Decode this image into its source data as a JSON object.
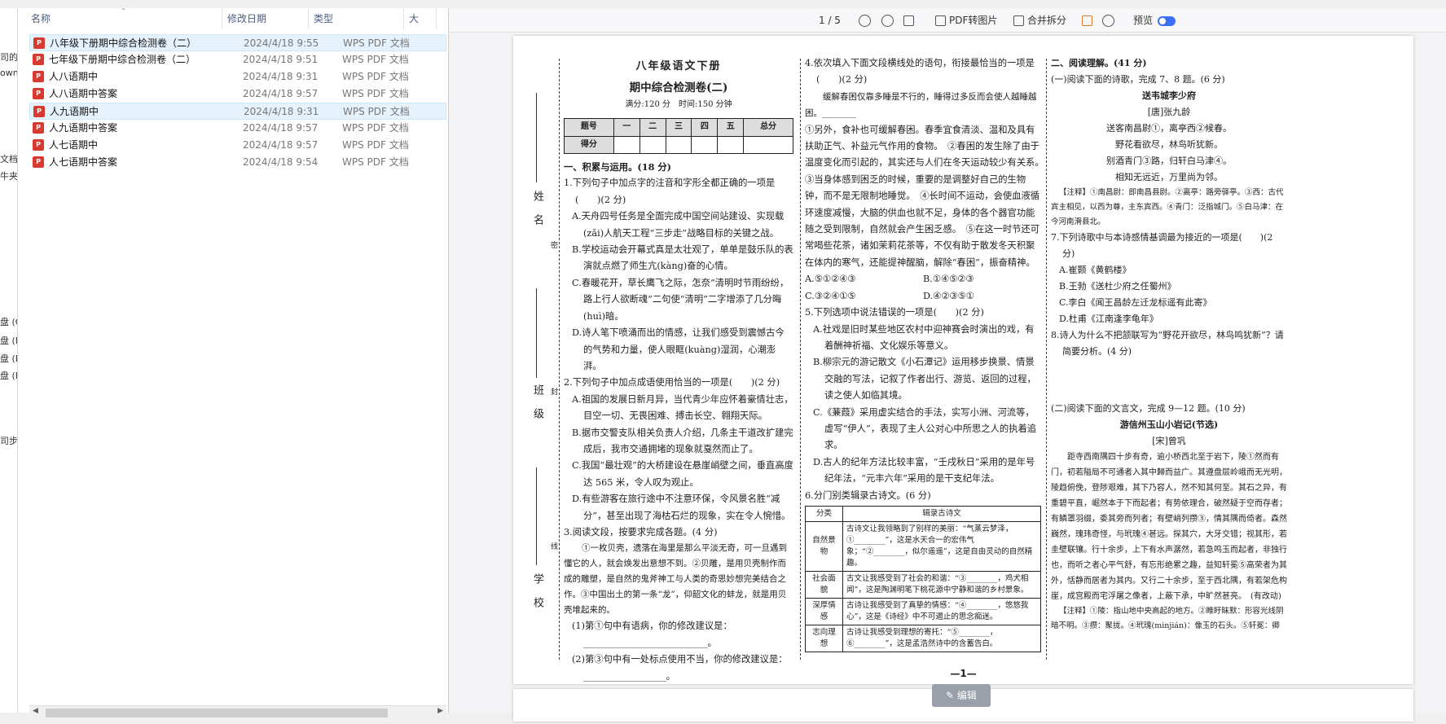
{
  "left_strip": {
    "items": [
      "司的",
      "own",
      "文档",
      "牛夹",
      "盘 (C",
      "盘 (D",
      "盘 (E",
      "盘 (F",
      "司步"
    ]
  },
  "explorer": {
    "columns": {
      "name": "名称",
      "date": "修改日期",
      "type": "类型",
      "size": "大"
    },
    "files": [
      {
        "name": "八年级下册期中综合检测卷（二）",
        "date": "2024/4/18 9:55",
        "type": "WPS PDF 文档",
        "selected": true
      },
      {
        "name": "七年级下册期中综合检测卷（二）",
        "date": "2024/4/18 9:51",
        "type": "WPS PDF 文档",
        "selected": false
      },
      {
        "name": "人八语期中",
        "date": "2024/4/18 9:31",
        "type": "WPS PDF 文档",
        "selected": false
      },
      {
        "name": "人八语期中答案",
        "date": "2024/4/18 9:57",
        "type": "WPS PDF 文档",
        "selected": false
      },
      {
        "name": "人九语期中",
        "date": "2024/4/18 9:31",
        "type": "WPS PDF 文档",
        "selected": true
      },
      {
        "name": "人九语期中答案",
        "date": "2024/4/18 9:57",
        "type": "WPS PDF 文档",
        "selected": false
      },
      {
        "name": "人七语期中",
        "date": "2024/4/18 9:57",
        "type": "WPS PDF 文档",
        "selected": false
      },
      {
        "name": "人七语期中答案",
        "date": "2024/4/18 9:54",
        "type": "WPS PDF 文档",
        "selected": false
      }
    ]
  },
  "toolbar": {
    "page_indicator": "1 / 5",
    "pdf_to_image": "PDF转图片",
    "merge_split": "合并拆分",
    "preview": "预览"
  },
  "doc": {
    "binding": {
      "name": "姓 名",
      "class": "班 级",
      "school": "学 校",
      "mi": "密",
      "feng": "封",
      "xian": "线"
    },
    "title1": "八年级语文下册",
    "title2": "期中综合检测卷(二)",
    "meta": "满分:120 分　时间:150 分钟",
    "score_head": [
      "题号",
      "一",
      "二",
      "三",
      "四",
      "五",
      "总分"
    ],
    "score_row": "得分",
    "col1": [
      "一、积累与运用。(18 分)",
      "1.下列句子中加点字的注音和字形全都正确的一项是(　　)(2 分)",
      "A.天舟四号任务是全面完成中国空间站建设、实现载(zǎi)人航天工程“三步走”战略目标的关键之战。",
      "B.学校运动会开幕式真是太壮观了，单单是鼓乐队的表演就点燃了师生亢(kàng)奋的心情。",
      "C.春暖花开，草长鹰飞之际，怎奈“清明时节雨纷纷，路上行人欲断魂”二句使“清明”二字增添了几分晦(huì)暗。",
      "D.诗人笔下喷涌而出的情感，让我们感受到震憾古今的气势和力量，使人眼眶(kuàng)湿润，心潮澎湃。",
      "2.下列句子中加点成语使用恰当的一项是(　　)(2 分)",
      "A.祖国的发展日新月异，当代青少年应怀着豪情壮志，目空一切、无畏困难、搏击长空、翱翔天际。",
      "B.据市交警支队相关负责人介绍，几条主干道改扩建完成后，我市交通拥堵的现象就戛然而止了。",
      "C.我国“最壮观”的大桥建设在悬崖峭壁之间，垂直高度达 565 米，令人叹为观止。",
      "D.有些游客在旅行途中不注意环保，令风景名胜“减分”，甚至出现了海枯石烂的现象，实在令人惋惜。",
      "3.阅读文段，按要求完成各题。(4 分)",
      "①一枚贝壳，遗落在海里是那么平淡无奇，可一旦遇到懂它的人，就会焕发出意想不到。②贝雕，是用贝壳制作而成的雕塑，是自然的鬼斧神工与人类的奇思妙想完美结合之作。③中国出土的第一条“龙”，仰韶文化的蚌龙，就是用贝壳堆起来的。",
      "(1)第①句中有语病，你的修改建议是：___________________________。",
      "(2)第③句中有一处标点使用不当，你的修改建议是：__________________。"
    ],
    "col2": [
      "4.依次填入下面文段横线处的语句，衔接最恰当的一项是(　　)(2 分)",
      "缓解春困仅靠多睡是不行的，睡得过多反而会使人越睡越困。________",
      "①另外，食补也可缓解春困。春季宜食清淡、温和及具有扶助正气、补益元气作用的食物。　②春困的发生除了由于温度变化而引起的，其实还与人们在冬天运动较少有关系。　③当身体感到困乏的时候，重要的是调整好自己的生物钟，而不是无限制地睡觉。　④长时间不运动，会使血液循环速度减慢，大脑的供血也就不足，身体的各个器官功能随之受到限制，自然就会产生困乏感。　⑤在这一时节还可常喝些花茶，诸如茉莉花茶等，不仅有助于散发冬天积聚在体内的寒气，还能提神醒脑，解除“春困”，振奋精神。",
      "5.下列选项中说法错误的一项是(　　)(2 分)",
      "A.社戏是旧时某些地区农村中迎神赛会时演出的戏，有着酬神祈福、文化娱乐等意义。",
      "B.柳宗元的游记散文《小石潭记》运用移步换景、情景交融的写法，记叙了作者出行、游览、返回的过程，读之使人如临其境。",
      "C.《蒹葭》采用虚实结合的手法，实写小洲、河流等，虚写“伊人”，表现了主人公对心中所思之人的执着追求。",
      "D.古人的纪年方法比较丰富，“壬戌秋日”采用的是年号纪年法，“元丰六年”采用的是干支纪年法。",
      "6.分门别类辑录古诗文。(6 分)"
    ],
    "col2_opts": [
      "A.⑤①②④③",
      "B.①④⑤②③",
      "C.③②④①⑤",
      "D.④②③⑤①"
    ],
    "poem_table": {
      "head": [
        "分类",
        "辑录古诗文"
      ],
      "rows": [
        {
          "k": "自然景物",
          "v": "古诗文让我领略到了别样的美丽：“气蒸云梦泽，①________”，这是水天合一的宏伟气象；“②________，似尔遥遥”，这是自由灵动的自然精趣。"
        },
        {
          "k": "社会面貌",
          "v": "古文让我感受到了社会的和谐：“③________，鸡犬相闻”，这是陶渊明笔下桃花源中宁静和谐的乡村景象。"
        },
        {
          "k": "深厚情感",
          "v": "古诗让我感受到了真挚的情感：“④________，悠悠我心”，这是《诗经》中不可遏止的思念痴迷。"
        },
        {
          "k": "志向理想",
          "v": "古诗让我感受到理想的寄托：“⑤________，⑥________”，这是孟浩然诗中的含蓄告白。"
        }
      ]
    },
    "col3": [
      "二、阅读理解。(41 分)",
      "(一)阅读下面的诗歌，完成 7、8 题。(6 分)",
      "送韦城李少府",
      "[唐]张九龄",
      "送客南昌尉①，离亭西②候春。",
      "野花看欲尽，林鸟听犹新。",
      "别酒青门③路，归轩白马津④。",
      "相知无远近，万里尚为邻。",
      "【注释】①南昌尉：即南昌县尉。②离亭：路旁驿亭。③西：古代宾主相见，以西为尊，主东宾西。④青门：泛指城门。⑤白马津：在今河南滑县北。",
      "7.下列诗歌中与本诗感情基调最为接近的一项是(　　)(2 分)",
      "A.崔颢《黄鹤楼》",
      "B.王勃《送杜少府之任蜀州》",
      "C.李白《闻王昌龄左迁龙标遥有此寄》",
      "D.杜甫《江南逢李龟年》",
      "8.诗人为什么不把颔联写为“野花开欲尽，林鸟鸣犹新”？请简要分析。(4 分)",
      "(二)阅读下面的文言文，完成 9—12 题。(10 分)",
      "游信州玉山小岩记(节选)",
      "[宋]曾巩",
      "距寺西南隅四十步有奇，逾小桥西北至于岩下，陵①然而有门，初若隘局不可通者入其中歸而益广。其遵盘层岭峨而无光明，陵趋俯俛，登陟艰难，其下乃容人，然不知其何至。其石之异，有重碧平直，崛然本于下而起者；有势依理合，破然疑于空而存者；有鳞罩羽缀，委其旁而列者；有壁峭列攒③，情其隅而倚者。森然巍然，瑰玮奇怪，与玳瑰④甚远。探其穴，大牙交错；视其形，若圭壁联镶。行十余步，上下有水声潺然，若急鸣玉而起者，非独行也，而听之者心平气舒，有忘形绝累之趣，益知轩冕⑤高荣者为其外，恬静而居者为其内。又行二十余步，至于西北隅，有若架危构崖，成宫殿而宅浮屠之像者，上蔽下承，中旷然甚亮。　(有改动)",
      "【注释】①陵：指山地中央高起的地方。②睢盱昧默：形容光线阴暗不明。③攒：聚拢。④玳瑰(minjián)：像玉的石头。⑤轩冕：卿"
    ],
    "page_number": "—1—",
    "edit_button": "编辑"
  }
}
